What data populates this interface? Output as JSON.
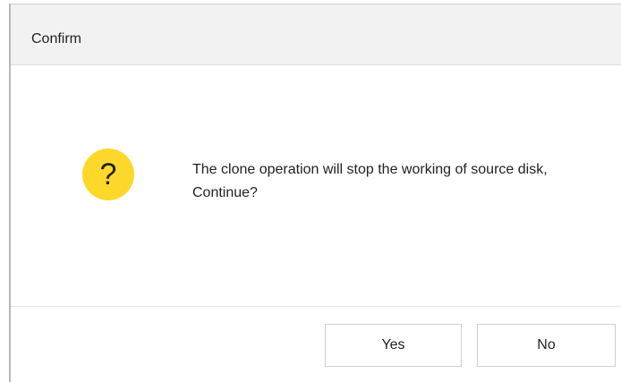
{
  "dialog": {
    "title": "Confirm",
    "icon": "question-mark-icon",
    "icon_glyph": "?",
    "icon_color": "#fdd82b",
    "message": "The clone operation will stop the working of source disk, Continue?",
    "buttons": {
      "yes_label": "Yes",
      "no_label": "No"
    }
  }
}
